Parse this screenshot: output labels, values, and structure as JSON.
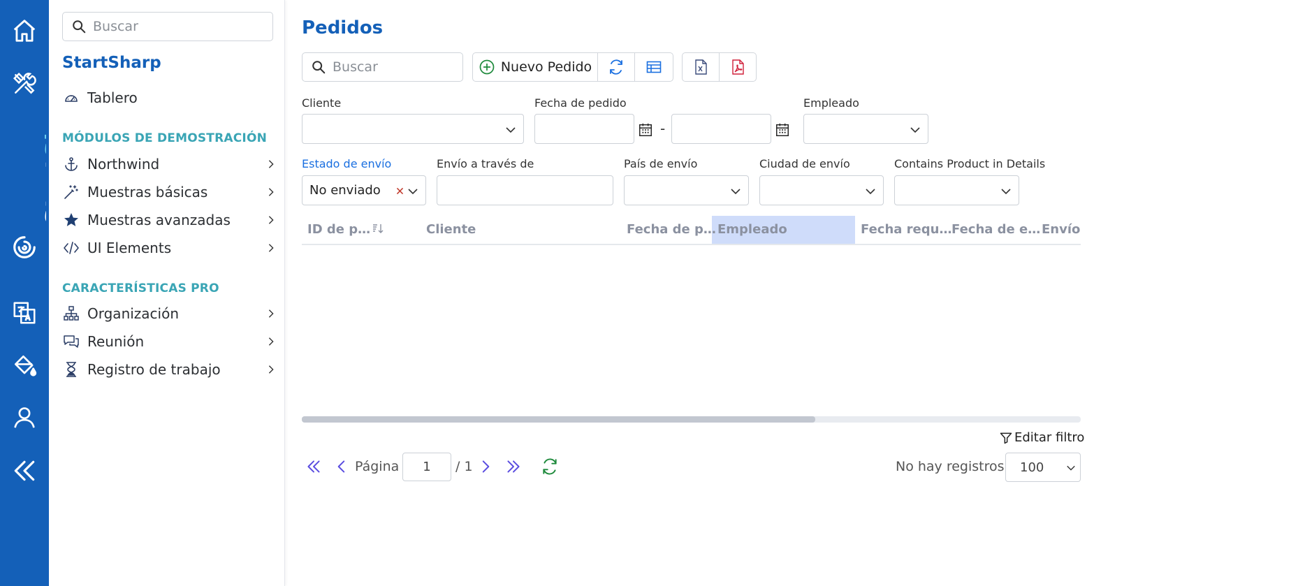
{
  "rail": {
    "brand_part1": "Start",
    "brand_part2": "Sharp",
    "icons": [
      "home-icon",
      "tools-icon",
      "translate-icon",
      "paint-bucket-icon",
      "user-icon",
      "collapse-icon"
    ]
  },
  "sidebar": {
    "search_placeholder": "Buscar",
    "app_name": "StartSharp",
    "dashboard": "Tablero",
    "section_demo": "MÓDULOS DE DEMOSTRACIÓN",
    "demo_items": [
      {
        "label": "Northwind",
        "icon": "anchor-icon"
      },
      {
        "label": "Muestras básicas",
        "icon": "magic-wand-icon"
      },
      {
        "label": "Muestras avanzadas",
        "icon": "star-icon"
      },
      {
        "label": "UI Elements",
        "icon": "code-icon"
      }
    ],
    "section_pro": "CARACTERÍSTICAS PRO",
    "pro_items": [
      {
        "label": "Organización",
        "icon": "org-chart-icon"
      },
      {
        "label": "Reunión",
        "icon": "chat-icon"
      },
      {
        "label": "Registro de trabajo",
        "icon": "hourglass-icon"
      }
    ]
  },
  "main": {
    "title": "Pedidos",
    "toolbar": {
      "search_placeholder": "Buscar",
      "new_order": "Nuevo Pedido"
    },
    "filters": {
      "cliente": "Cliente",
      "fecha_pedido": "Fecha de pedido",
      "date_sep": "-",
      "empleado": "Empleado",
      "estado_envio": "Estado de envío",
      "estado_envio_value": "No enviado",
      "envio_traves": "Envío a través de",
      "pais_envio": "País de envío",
      "ciudad_envio": "Ciudad de envío",
      "contains_product": "Contains Product in Details"
    },
    "grid": {
      "columns": [
        "ID de p…",
        "Cliente",
        "Fecha de p…",
        "Empleado",
        "Fecha requ…",
        "Fecha de e…",
        "Envío a"
      ]
    },
    "footer": {
      "edit_filter": "Editar filtro",
      "page_label": "Página",
      "page_value": "1",
      "page_total": "/ 1",
      "no_records": "No hay registros",
      "page_size": "100"
    },
    "colors": {
      "accent": "#1460b8",
      "section": "#3aa5b5",
      "header_selected": "#cfdcfa"
    }
  }
}
